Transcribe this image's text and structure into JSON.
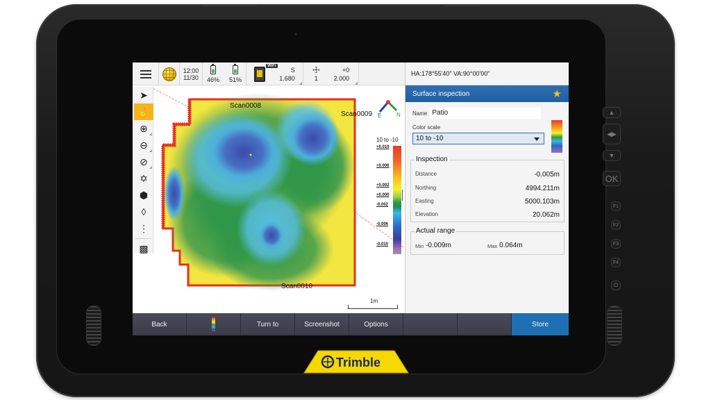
{
  "device": {
    "brand": "Trimble",
    "hardware_keys": [
      "up",
      "left-right",
      "down",
      "OK",
      "F1",
      "F2",
      "F3",
      "F4",
      "power"
    ],
    "hardware_key_labels": {
      "ok": "OK",
      "f1": "F1",
      "f2": "F2",
      "f3": "F3",
      "f4": "F4"
    }
  },
  "statusbar": {
    "time": "12:00",
    "date": "11/30",
    "battery1": "46%",
    "battery2": "51%",
    "wifi_badge": "WiFi",
    "instrument_mode": "S",
    "instrument_value": "1.680",
    "target_number": "1",
    "target_offset": "+0",
    "target_height": "2.000"
  },
  "angles": "HA:178°55'40\"  VA:90°00'00\"",
  "toolbar": {
    "tools": [
      "select",
      "pan",
      "zoom-in",
      "zoom-out",
      "zoom-extents",
      "orbit",
      "3d-view",
      "layers",
      "more",
      "video"
    ]
  },
  "map": {
    "scan_labels": [
      "Scan0008",
      "Scan0009",
      "Scan0010"
    ],
    "compass": {
      "e": "E",
      "n": "N"
    },
    "legend_title": "10 to -10",
    "legend_ticks": [
      "+0.010",
      "+0.006",
      "+0.002",
      "+0.000",
      "-0.002",
      "-0.006",
      "-0.010"
    ],
    "scale_label": "1m"
  },
  "panel": {
    "title": "Surface inspection",
    "name_label": "Name",
    "name_value": "Patio",
    "color_scale_label": "Color scale",
    "color_scale_value": "10 to -10",
    "inspection": {
      "title": "Inspection",
      "rows": [
        {
          "label": "Distance",
          "value": "-0.005m"
        },
        {
          "label": "Northing",
          "value": "4994.211m"
        },
        {
          "label": "Easting",
          "value": "5000.103m"
        },
        {
          "label": "Elevation",
          "value": "20.062m"
        }
      ]
    },
    "actual_range": {
      "title": "Actual range",
      "min_label": "Min",
      "min_value": "-0.009m",
      "max_label": "Max",
      "max_value": "0.064m"
    }
  },
  "bottombar": {
    "back": "Back",
    "turn_to": "Turn to",
    "screenshot": "Screenshot",
    "options": "Options",
    "store": "Store"
  },
  "colors": {
    "accent_blue": "#1f6fb3",
    "active_tool": "#f4b41a",
    "star": "#f5c518",
    "logo_yellow": "#f5d800",
    "logo_blue": "#1b2a6b"
  }
}
